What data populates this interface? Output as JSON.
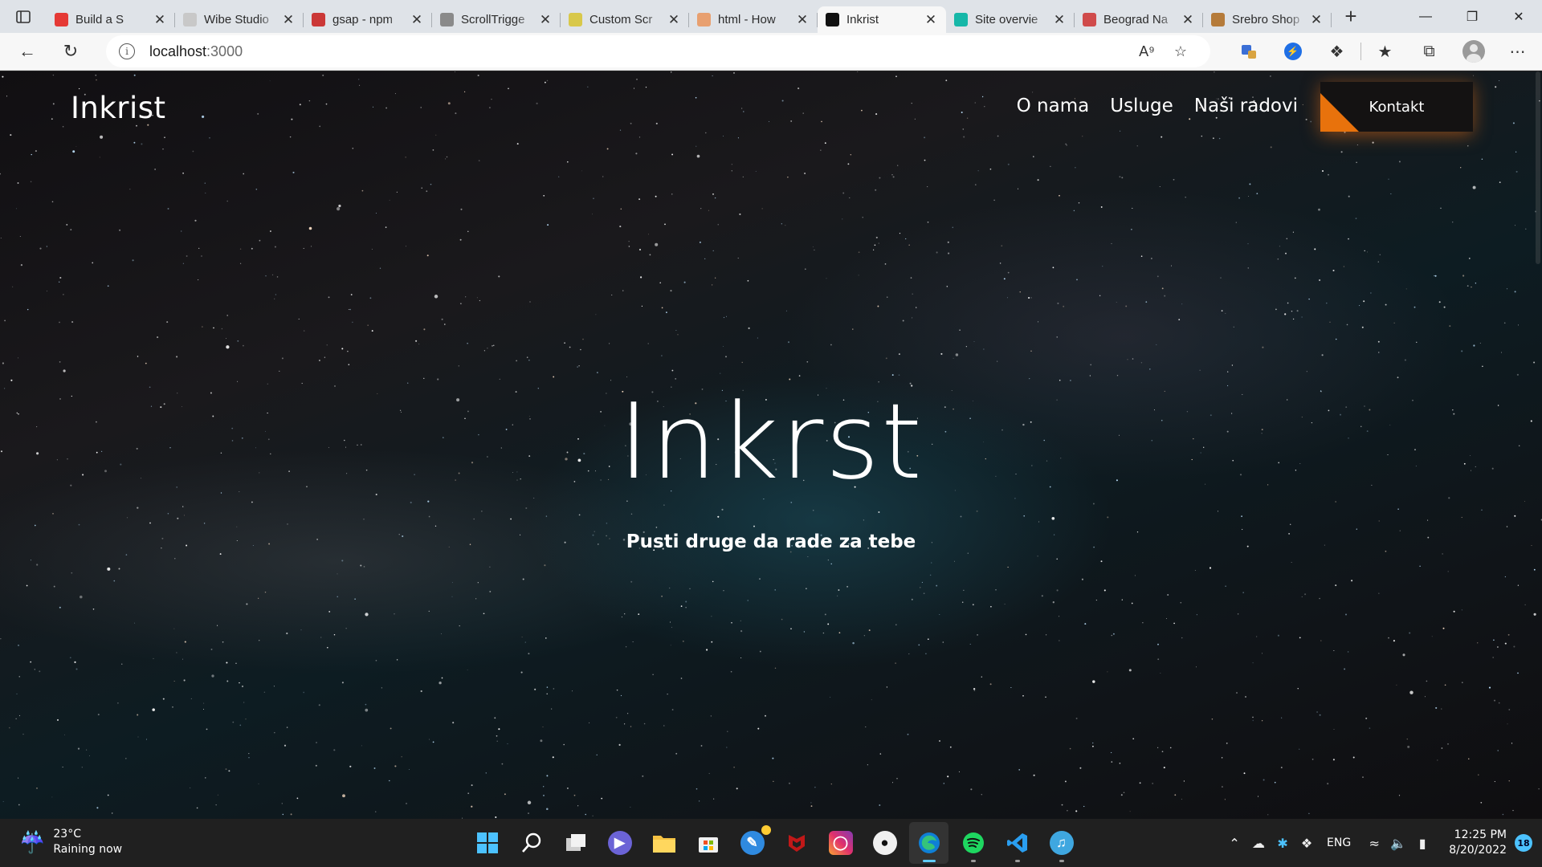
{
  "browser": {
    "tabs": [
      {
        "title": "Build a S",
        "favicon": "youtube-icon",
        "color": "#e53935"
      },
      {
        "title": "Wibe Studio",
        "favicon": "star-icon",
        "color": "#c8c8c8"
      },
      {
        "title": "gsap - npm",
        "favicon": "npm-icon",
        "color": "#cb3837"
      },
      {
        "title": "ScrollTrigge",
        "favicon": "scrolltrigger-icon",
        "color": "#8a8a8a"
      },
      {
        "title": "Custom Scr",
        "favicon": "js-icon",
        "color": "#d8c84a"
      },
      {
        "title": "html - How",
        "favicon": "stackoverflow-icon",
        "color": "#e8a070"
      },
      {
        "title": "Inkrist",
        "favicon": "triangle-icon",
        "color": "#111111"
      },
      {
        "title": "Site overvie",
        "favicon": "netlify-icon",
        "color": "#16b7a8"
      },
      {
        "title": "Beograd Na",
        "favicon": "chart-icon",
        "color": "#d04b4b"
      },
      {
        "title": "Srebro Shop",
        "favicon": "shop-icon",
        "color": "#b57b3a"
      }
    ],
    "active_tab_index": 6,
    "url_host": "localhost",
    "url_port": ":3000"
  },
  "site": {
    "brand": "Inkrist",
    "nav": {
      "o_nama": "O nama",
      "usluge": "Usluge",
      "nasi_radovi": "Naši radovi",
      "kontakt": "Kontakt"
    },
    "hero": {
      "title": "Inkrst",
      "subtitle": "Pusti druge da rade za tebe"
    },
    "accent_color": "#e8720c"
  },
  "taskbar": {
    "weather": {
      "temp": "23°C",
      "status": "Raining now"
    },
    "language": "ENG",
    "time": "12:25 PM",
    "date": "8/20/2022",
    "notifications": "18",
    "pinned_apps": [
      "windows-start-icon",
      "search-icon",
      "task-view-icon",
      "chat-icon",
      "file-explorer-icon",
      "store-icon",
      "app-icon",
      "mcafee-icon",
      "instagram-icon",
      "github-icon",
      "edge-icon",
      "spotify-icon",
      "vscode-icon",
      "app-icon-2"
    ]
  }
}
